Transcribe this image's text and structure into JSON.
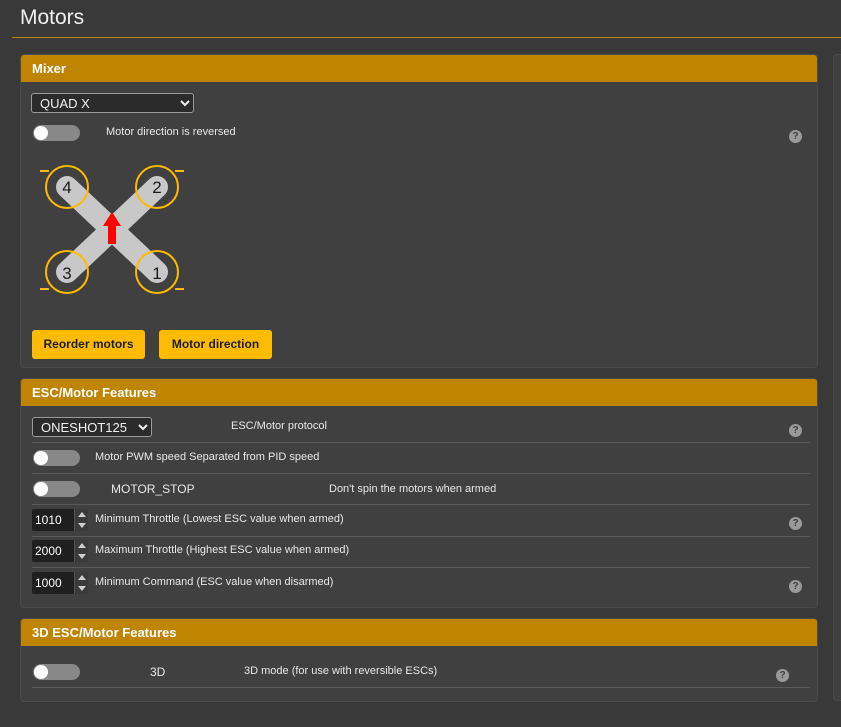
{
  "page": {
    "title": "Motors"
  },
  "mixer": {
    "header": "Mixer",
    "selected": "QUAD X",
    "reversed_label": "Motor direction is reversed",
    "motor_numbers": [
      "4",
      "2",
      "3",
      "1"
    ],
    "reorder_label": "Reorder motors",
    "direction_label": "Motor direction"
  },
  "esc": {
    "header": "ESC/Motor Features",
    "protocol_selected": "ONESHOT125",
    "protocol_label": "ESC/Motor protocol",
    "pwm_label": "Motor PWM speed Separated from PID speed",
    "motor_stop_label": "MOTOR_STOP",
    "motor_stop_desc": "Don't spin the motors when armed",
    "min_throttle_value": "1010",
    "min_throttle_label": "Minimum Throttle (Lowest ESC value when armed)",
    "max_throttle_value": "2000",
    "max_throttle_label": "Maximum Throttle (Highest ESC value when armed)",
    "min_command_value": "1000",
    "min_command_label": "Minimum Command (ESC value when disarmed)"
  },
  "esc3d": {
    "header": "3D ESC/Motor Features",
    "label": "3D",
    "desc": "3D mode (for use with reversible ESCs)"
  },
  "help_glyph": "?",
  "colors": {
    "accent": "#bf8500",
    "button": "#ffbb00",
    "prop_ring": "#ffbb00",
    "arrow": "#ff0000"
  }
}
